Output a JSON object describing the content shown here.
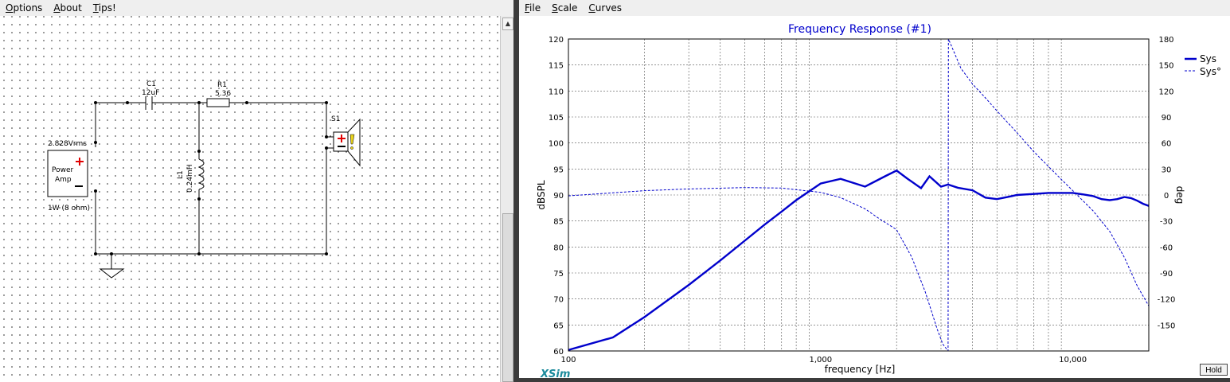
{
  "left_menu": [
    "Options",
    "About",
    "Tips!"
  ],
  "right_menu": [
    "File",
    "Scale",
    "Curves"
  ],
  "schematic": {
    "amp": {
      "voltage": "2.828Vrms",
      "line1": "Power",
      "line2": "Amp",
      "rating": "1W (8 ohm)"
    },
    "c1": {
      "name": "C1",
      "value": "12uF"
    },
    "r1": {
      "name": "R1",
      "value": "5.36"
    },
    "l1": {
      "name": "L1",
      "value": "0.24mH"
    },
    "s1": {
      "name": "S1"
    }
  },
  "chart_data": {
    "type": "line",
    "title": "Frequency Response (#1)",
    "xlabel": "frequency [Hz]",
    "ylabel": "dBSPL",
    "y2label": "deg",
    "xscale": "log",
    "xlim": [
      100,
      20000
    ],
    "ylim": [
      60,
      120
    ],
    "y2lim": [
      -180,
      180
    ],
    "xticks": [
      100,
      1000,
      10000
    ],
    "xtick_labels": [
      "100",
      "1,000",
      "10,000"
    ],
    "yticks": [
      60,
      65,
      70,
      75,
      80,
      85,
      90,
      95,
      100,
      105,
      110,
      115,
      120
    ],
    "y2ticks": [
      -150,
      -120,
      -90,
      -60,
      -30,
      0,
      30,
      60,
      90,
      120,
      150,
      180
    ],
    "grid": true,
    "legend_position": "top-right",
    "series": [
      {
        "name": "Sys",
        "axis": "left",
        "style": "thick",
        "color": "#0000cc",
        "x": [
          100,
          150,
          200,
          300,
          400,
          500,
          600,
          700,
          800,
          1000,
          1200,
          1500,
          1800,
          2000,
          2200,
          2500,
          2700,
          3000,
          3200,
          3500,
          4000,
          4500,
          5000,
          5500,
          6000,
          7000,
          8000,
          9000,
          10000,
          11000,
          12000,
          13000,
          14000,
          15000,
          16000,
          17000,
          18000,
          19000,
          20000
        ],
        "y": [
          60.2,
          62.6,
          66.5,
          72.7,
          77.4,
          81.2,
          84.3,
          86.8,
          89.0,
          92.2,
          93.1,
          91.6,
          93.6,
          94.7,
          93.2,
          91.3,
          93.6,
          91.6,
          92.0,
          91.4,
          90.9,
          89.5,
          89.2,
          89.6,
          90.0,
          90.2,
          90.4,
          90.4,
          90.4,
          90.1,
          89.8,
          89.2,
          89.0,
          89.2,
          89.6,
          89.4,
          88.9,
          88.3,
          87.9
        ],
        "x_note": "thick series in dBSPL vs Hz"
      },
      {
        "name": "Sys°",
        "axis": "right",
        "style": "dashed",
        "color": "#0000cc",
        "x": [
          100,
          200,
          300,
          500,
          700,
          1000,
          1200,
          1500,
          1700,
          2000,
          2300,
          2600,
          2900,
          3050,
          3200,
          3210,
          3300,
          3600,
          4000,
          4500,
          5000,
          6000,
          7000,
          8000,
          9000,
          10000,
          12000,
          14000,
          16000,
          18000,
          20000
        ],
        "y": [
          -1,
          5,
          7,
          8.5,
          8,
          3,
          -3,
          -16,
          -27,
          -40,
          -72,
          -112,
          -155,
          -172,
          -180,
          180,
          172,
          146,
          128,
          112,
          97,
          72,
          50,
          33,
          18,
          5,
          -18,
          -42,
          -72,
          -105,
          -128
        ]
      }
    ]
  }
}
